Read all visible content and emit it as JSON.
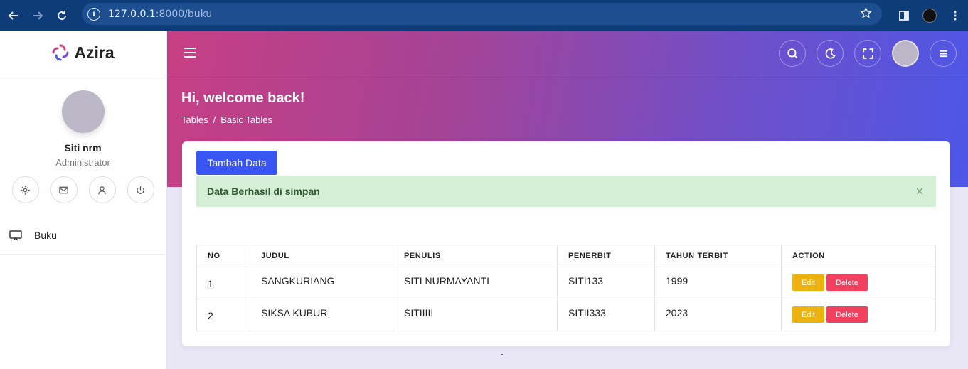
{
  "browser": {
    "url_host": "127.0.0.1",
    "url_path": ":8000/buku"
  },
  "sidebar": {
    "brand": "Azira",
    "user_name": "Siti nrm",
    "user_role": "Administrator",
    "quick_icons": [
      "settings-icon",
      "mail-icon",
      "user-icon",
      "power-icon"
    ],
    "menu": [
      {
        "label": "Buku",
        "icon": "monitor-icon"
      }
    ]
  },
  "header": {
    "welcome": "Hi, welcome back!",
    "breadcrumb": [
      "Tables",
      "Basic Tables"
    ],
    "breadcrumb_sep": "/"
  },
  "main": {
    "add_button": "Tambah Data",
    "alert": {
      "text": "Data Berhasil di simpan",
      "close": "×"
    },
    "table": {
      "columns": [
        "NO",
        "JUDUL",
        "PENULIS",
        "PENERBIT",
        "TAHUN TERBIT",
        "ACTION"
      ],
      "rows": [
        {
          "no": "1",
          "judul": "SANGKURIANG",
          "penulis": "SITI NURMAYANTI",
          "penerbit": "SITI133",
          "tahun": "1999"
        },
        {
          "no": "2",
          "judul": "SIKSA KUBUR",
          "penulis": "SITIIIII",
          "penerbit": "SITII333",
          "tahun": "2023"
        }
      ],
      "edit_label": "Edit",
      "delete_label": "Delete"
    }
  },
  "colors": {
    "primary": "#3a56f2",
    "edit": "#ecb310",
    "delete": "#f2415f",
    "alert_bg": "#d5efd6",
    "gradient_start": "#c73f84",
    "gradient_end": "#4d57e6"
  }
}
